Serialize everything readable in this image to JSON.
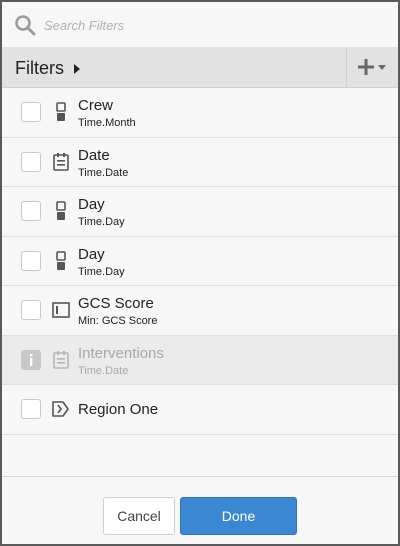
{
  "search": {
    "placeholder": "Search Filters",
    "icon": "search-icon"
  },
  "header": {
    "title": "Filters",
    "add_icon": "plus-icon",
    "dropdown_icon": "caret-down-icon"
  },
  "filters": [
    {
      "name": "Crew",
      "subtitle": "Time.Month",
      "icon": "time-icon",
      "checked": false,
      "disabled": false
    },
    {
      "name": "Date",
      "subtitle": "Time.Date",
      "icon": "calendar-icon",
      "checked": false,
      "disabled": false
    },
    {
      "name": "Day",
      "subtitle": "Time.Day",
      "icon": "time-icon",
      "checked": false,
      "disabled": false
    },
    {
      "name": "Day",
      "subtitle": "Time.Day",
      "icon": "time-icon",
      "checked": false,
      "disabled": false
    },
    {
      "name": "GCS Score",
      "subtitle": "Min: GCS Score",
      "icon": "measure-icon",
      "checked": false,
      "disabled": false
    },
    {
      "name": "Interventions",
      "subtitle": "Time.Date",
      "icon": "calendar-icon",
      "checked": false,
      "disabled": true
    },
    {
      "name": "Region One",
      "subtitle": "",
      "icon": "hierarchy-icon",
      "checked": false,
      "disabled": false
    }
  ],
  "footer": {
    "cancel_label": "Cancel",
    "done_label": "Done"
  },
  "colors": {
    "accent": "#3b87d3",
    "header_bg": "#e2e2e2",
    "panel_bg": "#f7f7f7",
    "disabled_bg": "#ebebeb"
  }
}
